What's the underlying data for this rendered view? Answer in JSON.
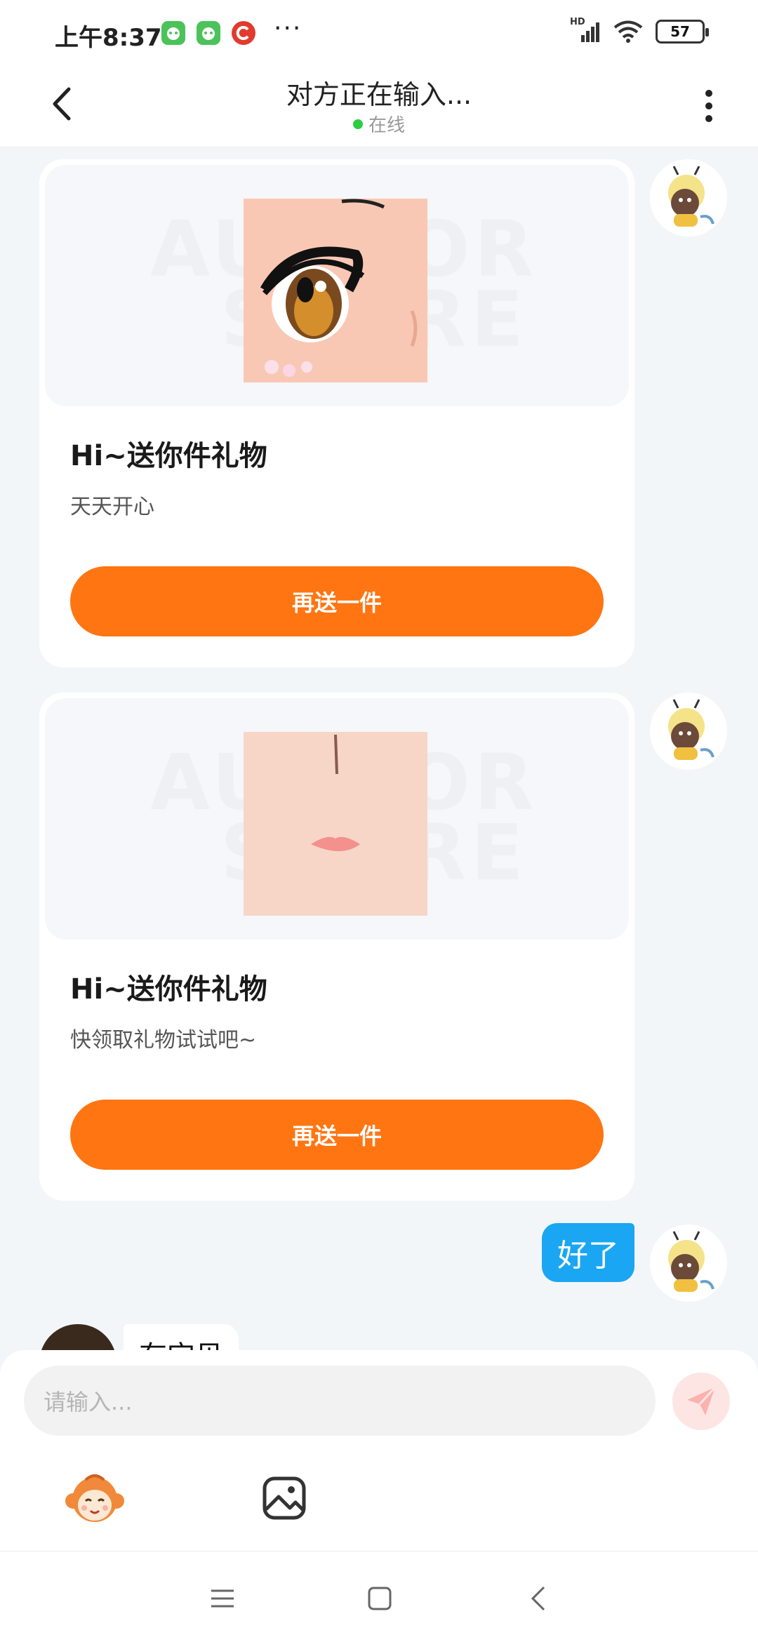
{
  "status": {
    "time": "上午8:37",
    "more": "···",
    "network": "HD",
    "battery": "57"
  },
  "header": {
    "title": "对方正在输入...",
    "status_text": "在线"
  },
  "messages": {
    "gift_1": {
      "watermark_line1": "AUTHOR",
      "watermark_line2": "STORE",
      "title": "Hi~送你件礼物",
      "desc": "天天开心",
      "button": "再送一件"
    },
    "gift_2": {
      "watermark_line1": "AUTHOR",
      "watermark_line2": "STORE",
      "title": "Hi~送你件礼物",
      "desc": "快领取礼物试试吧~",
      "button": "再送一件"
    },
    "text_right": "好了",
    "text_left": "有宝贝"
  },
  "input": {
    "placeholder": "请输入..."
  },
  "colors": {
    "accent_orange": "#ff7512",
    "bubble_blue": "#1aa6f2",
    "online_green": "#2ecc40"
  },
  "icons": {
    "back": "chevron-left-icon",
    "more": "more-vertical-icon",
    "send": "send-plane-icon",
    "sticker": "monkey-sticker-icon",
    "image": "image-icon",
    "nav_menu": "menu-icon",
    "nav_home": "square-home-icon",
    "nav_back": "triangle-back-icon"
  }
}
